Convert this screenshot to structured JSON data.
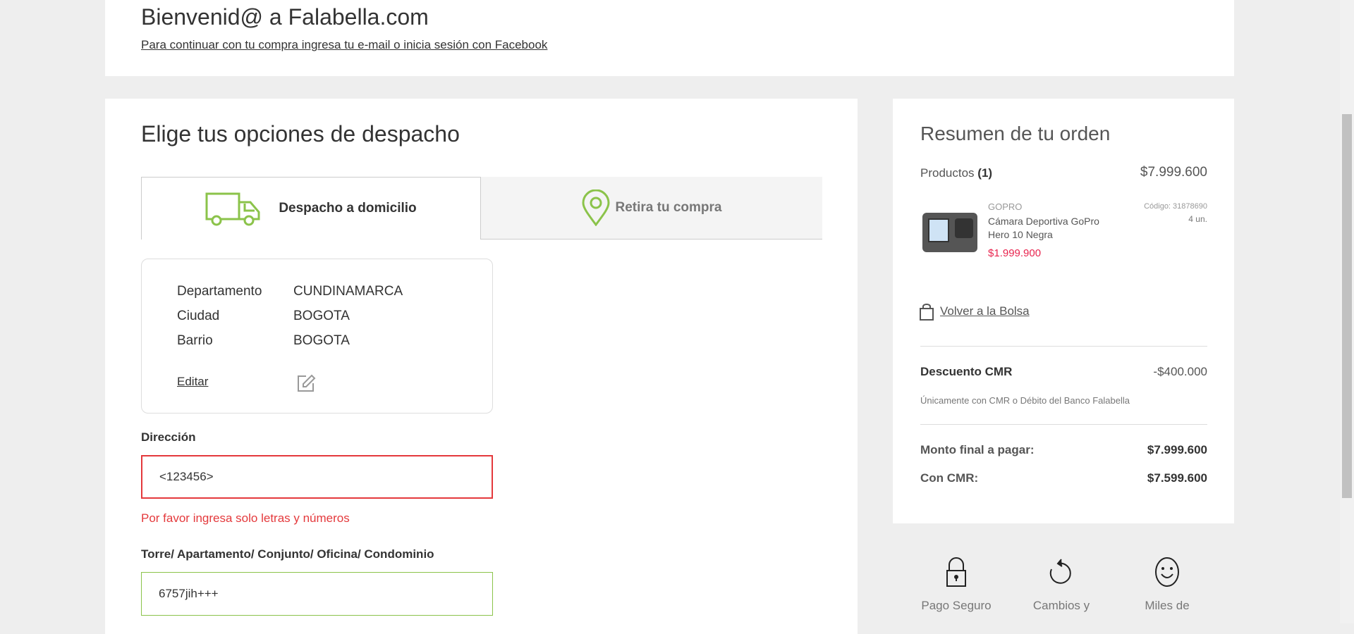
{
  "header": {
    "title": "Bienvenid@ a Falabella.com",
    "subtitle": "Para continuar con tu compra ingresa tu e-mail o inicia sesión con Facebook"
  },
  "shipping": {
    "title": "Elige tus opciones de despacho",
    "tabs": [
      {
        "label": "Despacho a domicilio",
        "icon": "truck-icon"
      },
      {
        "label": "Retira tu compra",
        "icon": "location-pin-icon"
      }
    ],
    "address": [
      {
        "label": "Departamento",
        "value": "CUNDINAMARCA"
      },
      {
        "label": "Ciudad",
        "value": "BOGOTA"
      },
      {
        "label": "Barrio",
        "value": "BOGOTA"
      }
    ],
    "edit_label": "Editar",
    "direccion_label": "Dirección",
    "direccion_value": "<123456>",
    "direccion_error": "Por favor ingresa solo letras y números",
    "torre_label": "Torre/ Apartamento/ Conjunto/ Oficina/ Condominio",
    "torre_value": "6757jih+++"
  },
  "summary": {
    "title": "Resumen de tu orden",
    "products_label": "Productos",
    "products_count": "(1)",
    "products_total": "$7.999.600",
    "product": {
      "brand": "GOPRO",
      "name": "Cámara Deportiva GoPro Hero 10 Negra",
      "price": "$1.999.900",
      "code": "Código: 31878690",
      "qty": "4 un."
    },
    "back_label": "Volver a la Bolsa",
    "discount_label": "Descuento CMR",
    "discount_value": "-$400.000",
    "discount_note": "Únicamente con CMR o Débito del Banco Falabella",
    "final_label": "Monto final a pagar:",
    "final_value": "$7.999.600",
    "cmr_label": "Con CMR:",
    "cmr_value": "$7.599.600"
  },
  "features": [
    {
      "label": "Pago Seguro"
    },
    {
      "label": "Cambios y"
    },
    {
      "label": "Miles de"
    }
  ],
  "colors": {
    "accent": "#8bc34a",
    "error": "#e4393c",
    "price": "#e8254f"
  }
}
